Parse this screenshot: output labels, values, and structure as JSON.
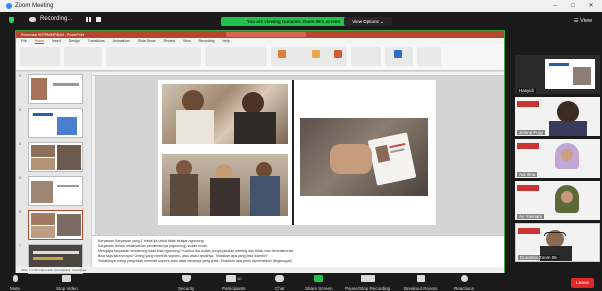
{
  "window": {
    "title": "Zoom Meeting",
    "controls": [
      "–",
      "□",
      "✕"
    ]
  },
  "topbar": {
    "recording_label": "Recording...",
    "pause_icon": "pause-icon",
    "stop_icon": "stop-icon",
    "banner_text": "You are viewing Dunamis Zoom 06's screen",
    "view_options_label": "View Options ⌄",
    "view_label": "View",
    "banner_color": "#23c14a"
  },
  "powerpoint": {
    "title_text": "Presentasi KEPEMIMPINAN - PowerPoint",
    "tabs": [
      "File",
      "Home",
      "Insert",
      "Design",
      "Transitions",
      "Animations",
      "Slide Show",
      "Review",
      "View",
      "Recording",
      "Help"
    ],
    "active_tab": "Home",
    "slide_numbers": [
      "2",
      "3",
      "4",
      "5",
      "6",
      "7",
      "8"
    ],
    "selected_slide": "7",
    "notes_lines": [
      "Karyawan Karyawan yang 1 minta Ija untuk tidak belajar ngomong.",
      "Karyawan terlalu melaksaklan pemikirannya (ngomong) sudah lunak.",
      "Mengapa karyawan cenderung tidak bisa ngomong? Karena dia sudah punya jabatan penting dan tidak mau berkolaborasi.",
      "Bisa saja karena apa? Orang yang memiliki supsen, atau atasi ramainya, Tindakan apa yang bisa diambil?",
      "Sebaliknya orang yang tidak memiliki supsen atau atasi ramanya yang jelas, Tindakan apa perlu diperhatikan (lingkungan)"
    ],
    "status_text": "Slide 7 of 25  Indonesian  Accessibility: Investigate",
    "accent_color": "#b7472a"
  },
  "participants": [
    {
      "name": "Hasyidi",
      "kind": "slide"
    },
    {
      "name": "Jelena Fujiy",
      "kind": "person"
    },
    {
      "name": "Adi Ilma",
      "kind": "person"
    },
    {
      "name": "Ari Yasriani",
      "kind": "person"
    },
    {
      "name": "Dunamis Zoom 06",
      "kind": "person",
      "active": true
    }
  ],
  "toolbar": {
    "items": [
      {
        "label": "Mute",
        "icon": "microphone-icon"
      },
      {
        "label": "Stop Video",
        "icon": "video-camera-icon"
      },
      {
        "label": "Security",
        "icon": "shield-icon"
      },
      {
        "label": "Participants",
        "icon": "people-icon",
        "count": "10"
      },
      {
        "label": "Chat",
        "icon": "chat-icon"
      },
      {
        "label": "Share Screen",
        "icon": "share-screen-icon"
      },
      {
        "label": "Pause/Stop Recording",
        "icon": "record-icon"
      },
      {
        "label": "Breakout Rooms",
        "icon": "breakout-rooms-icon"
      },
      {
        "label": "Reactions",
        "icon": "reactions-icon"
      }
    ],
    "leave_label": "Leave",
    "leave_color": "#e02828"
  }
}
